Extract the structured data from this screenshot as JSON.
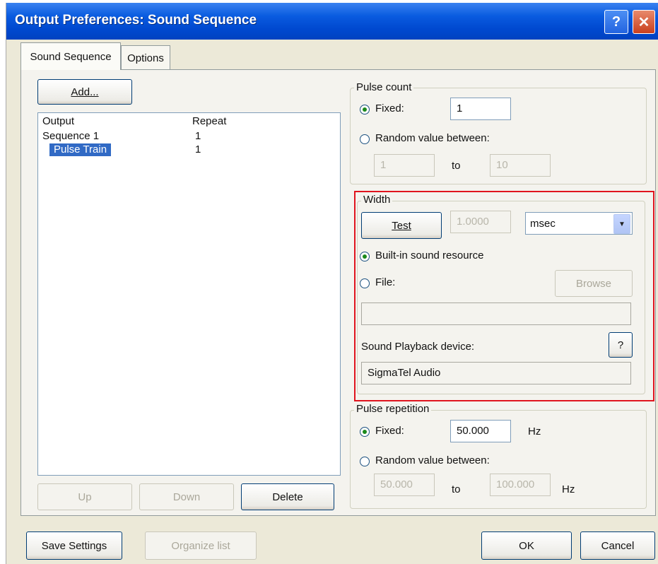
{
  "window": {
    "title": "Output Preferences: Sound Sequence",
    "help_glyph": "?",
    "close_glyph": "✕"
  },
  "tabs": [
    {
      "label": "Sound Sequence",
      "active": true
    },
    {
      "label": "Options",
      "active": false
    }
  ],
  "left": {
    "add_label": "Add...",
    "list": {
      "columns": [
        "Output",
        "Repeat"
      ],
      "rows": [
        {
          "output": "Sequence 1",
          "repeat": "1",
          "selected": false
        },
        {
          "output": "Pulse Train",
          "repeat": "1",
          "selected": true
        }
      ]
    },
    "up_label": "Up",
    "down_label": "Down",
    "delete_label": "Delete"
  },
  "pulse_count": {
    "legend": "Pulse count",
    "fixed_label": "Fixed:",
    "fixed_value": "1",
    "random_label": "Random value between:",
    "random_from": "1",
    "to_label": "to",
    "random_to": "10",
    "selected": "fixed"
  },
  "width": {
    "legend": "Width",
    "test_label": "Test",
    "value": "1.0000",
    "unit": "msec",
    "builtin_label": "Built-in sound resource",
    "file_label": "File:",
    "browse_label": "Browse",
    "file_path": "",
    "device_label": "Sound Playback device:",
    "device_help": "?",
    "device_value": "SigmaTel Audio",
    "selected": "builtin"
  },
  "pulse_repetition": {
    "legend": "Pulse repetition",
    "fixed_label": "Fixed:",
    "fixed_value": "50.000",
    "hz_label": "Hz",
    "random_label": "Random value between:",
    "random_from": "50.000",
    "to_label": "to",
    "random_to": "100.000",
    "selected": "fixed"
  },
  "footer": {
    "save_label": "Save Settings",
    "organize_label": "Organize list",
    "ok_label": "OK",
    "cancel_label": "Cancel"
  },
  "colors": {
    "titlebar": "#0049d0",
    "highlight_box": "#e0141e",
    "selection": "#316ac5"
  }
}
